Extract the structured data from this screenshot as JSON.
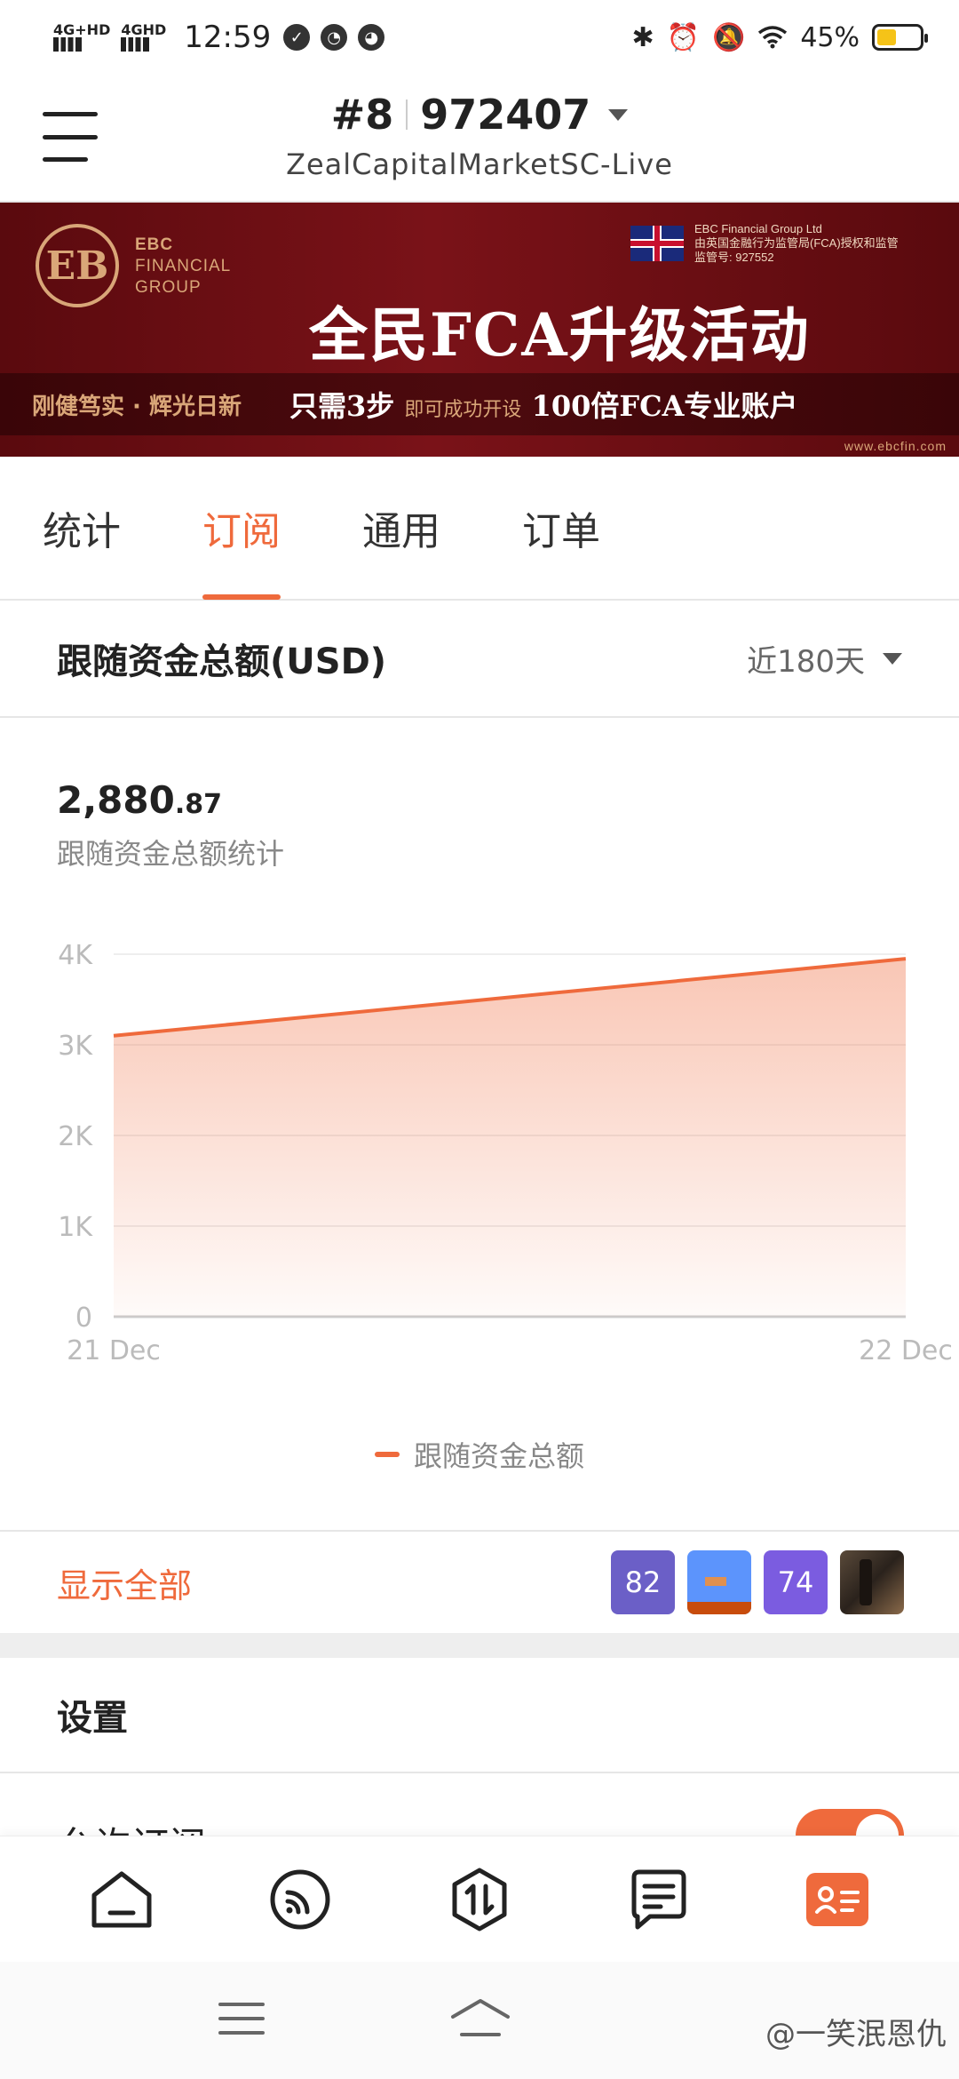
{
  "status_bar": {
    "network1": "4G+HD",
    "network2": "4GHD",
    "time": "12:59",
    "battery": "45%",
    "battery_level": 0.45
  },
  "header": {
    "account_prefix": "#8",
    "account_number": "972407",
    "server": "ZealCapitalMarketSC-Live"
  },
  "banner": {
    "logo_mark": "EB",
    "logo_line1": "EBC",
    "logo_line2": "FINANCIAL",
    "logo_line3": "GROUP",
    "fca_line1": "EBC Financial Group Ltd",
    "fca_line2": "由英国金融行为监管局(FCA)授权和监管",
    "fca_line3": "监管号: 927552",
    "headline": "全民FCA升级活动",
    "slogan": "刚健笃实 · 辉光日新",
    "steps_main1": "只需3步",
    "steps_small": "即可成功开设",
    "steps_main2": "100倍FCA专业账户",
    "site": "www.ebcfin.com"
  },
  "tabs": [
    {
      "label": "统计"
    },
    {
      "label": "订阅"
    },
    {
      "label": "通用"
    },
    {
      "label": "订单"
    }
  ],
  "active_tab": "订阅",
  "section": {
    "title": "跟随资金总额(USD)",
    "period": "近180天"
  },
  "summary": {
    "total_main": "2,880",
    "total_decimal": ".87",
    "label": "跟随资金总额统计"
  },
  "chart_data": {
    "type": "area",
    "x": [
      "21 Dec",
      "22 Dec"
    ],
    "series": [
      {
        "name": "跟随资金总额",
        "values": [
          3100,
          3950
        ]
      }
    ],
    "y_ticks": [
      "0",
      "1K",
      "2K",
      "3K",
      "4K"
    ],
    "ylim": [
      0,
      4000
    ],
    "grid": true,
    "legend_position": "bottom",
    "color": "#ef6a3c"
  },
  "show_all": "显示全部",
  "subscribers": [
    {
      "kind": "number",
      "label": "82",
      "color": "#6b5fc7"
    },
    {
      "kind": "image",
      "label": ""
    },
    {
      "kind": "number",
      "label": "74",
      "color": "#7b5ce0"
    },
    {
      "kind": "image",
      "label": ""
    }
  ],
  "settings": {
    "title": "设置",
    "allow_subscribe": "允许订阅",
    "allow_subscribe_on": true
  },
  "bottom_nav": [
    {
      "icon": "home-icon"
    },
    {
      "icon": "signal-icon"
    },
    {
      "icon": "trade-icon"
    },
    {
      "icon": "orders-icon"
    },
    {
      "icon": "profile-icon",
      "active": true
    }
  ],
  "watermark": "@一笑泯恩仇",
  "colors": {
    "accent": "#ef6a3c",
    "banner_bg": "#7a1218",
    "banner_gold": "#d9a678"
  }
}
